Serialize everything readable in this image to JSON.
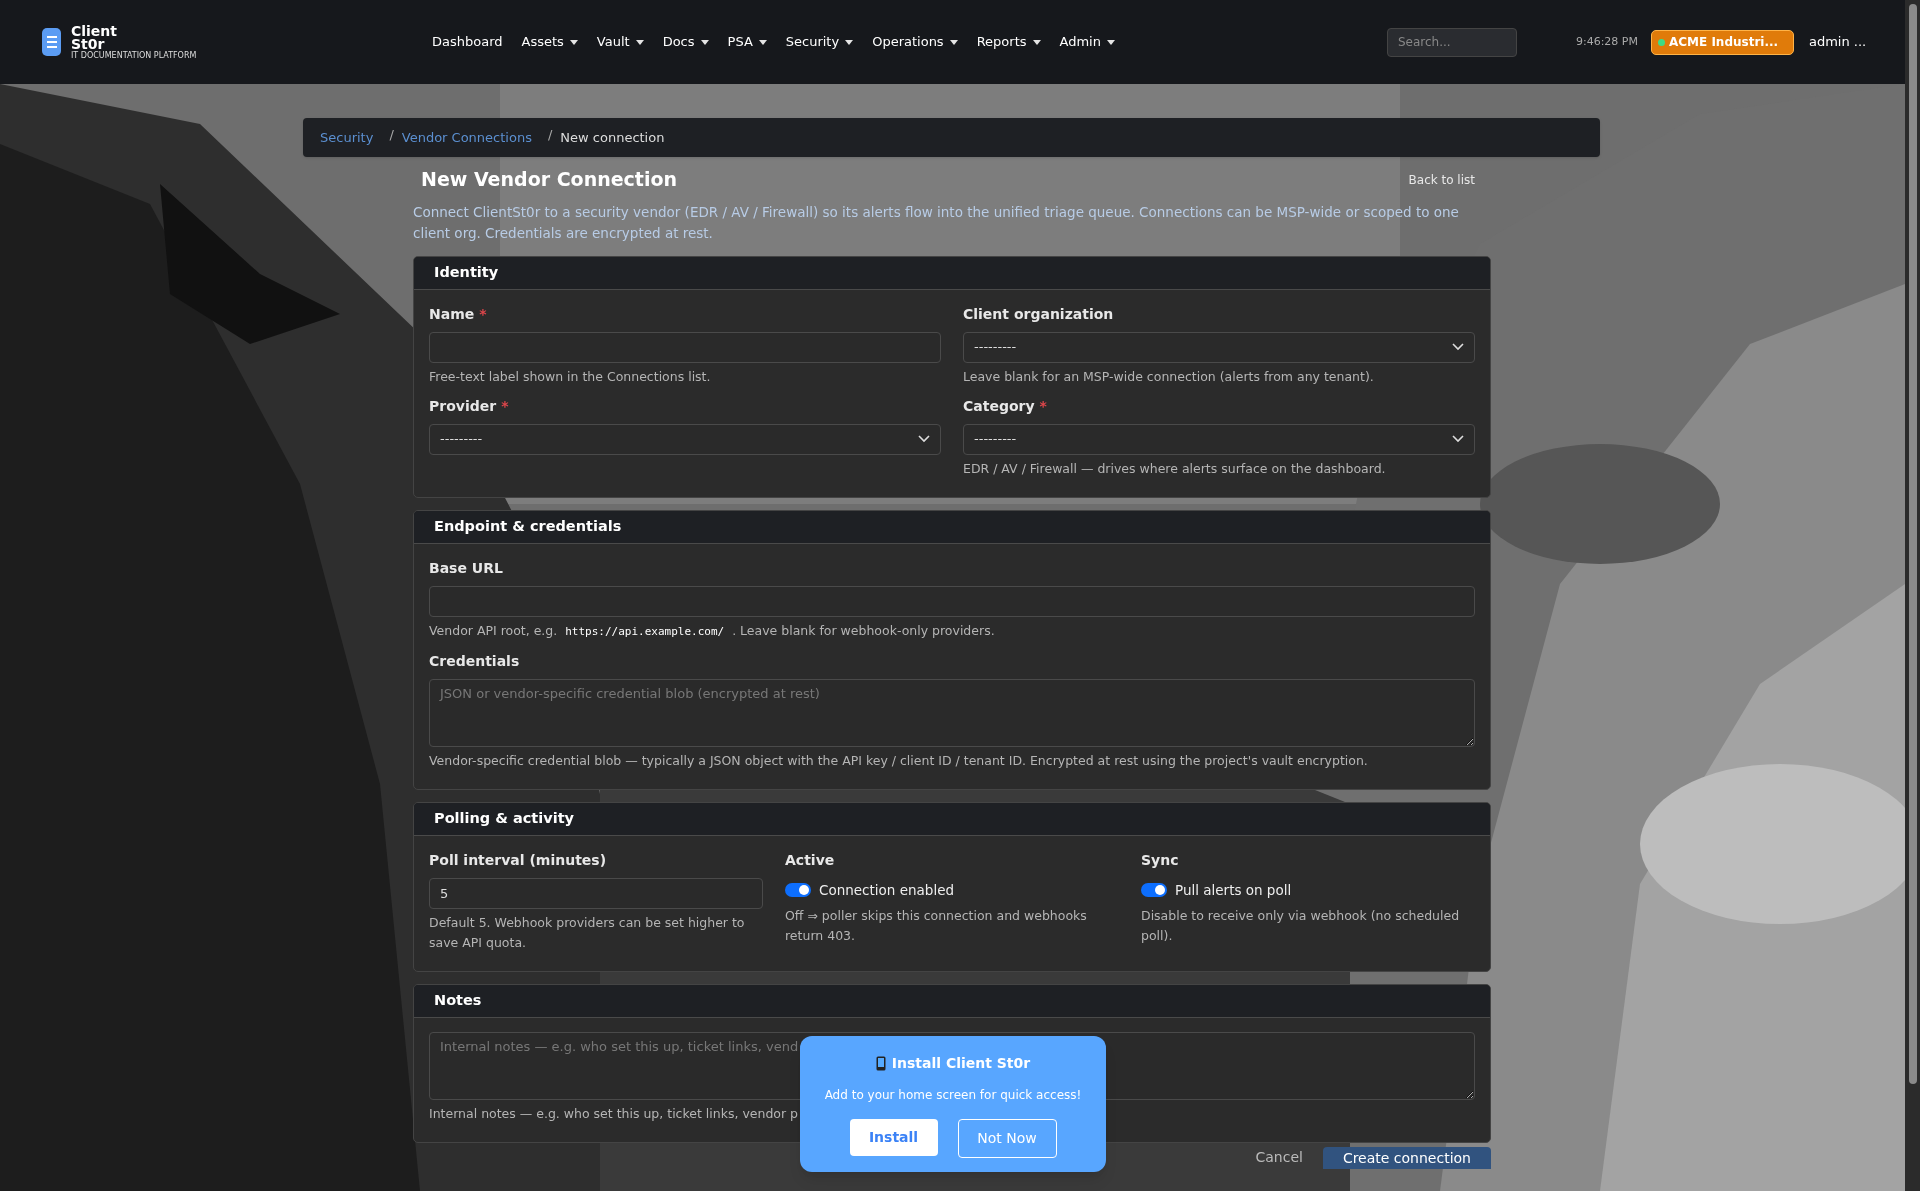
{
  "header": {
    "logo": {
      "title": "Client",
      "subtitle": "St0r",
      "tagline": "IT DOCUMENTATION PLATFORM"
    },
    "nav": [
      {
        "label": "Dashboard",
        "dropdown": false
      },
      {
        "label": "Assets",
        "dropdown": true
      },
      {
        "label": "Vault",
        "dropdown": true
      },
      {
        "label": "Docs",
        "dropdown": true
      },
      {
        "label": "PSA",
        "dropdown": true
      },
      {
        "label": "Security",
        "dropdown": true
      },
      {
        "label": "Operations",
        "dropdown": true
      },
      {
        "label": "Reports",
        "dropdown": true
      },
      {
        "label": "Admin",
        "dropdown": true
      }
    ],
    "search": {
      "placeholder": "Search..."
    },
    "clock": "9:46:28 PM",
    "org": "ACME Industri...",
    "user": "admin ..."
  },
  "breadcrumb": [
    {
      "label": "Security",
      "link": true
    },
    {
      "label": "Vendor Connections",
      "link": true,
      "separator": "/"
    },
    {
      "label": "New connection",
      "link": false,
      "separator": "/"
    }
  ],
  "page": {
    "title": "New Vendor Connection",
    "back_link": "Back to list",
    "description": "Connect ClientSt0r to a security vendor (EDR / AV / Firewall) so its alerts flow into the unified triage queue. Connections can be MSP-wide or scoped to one client org. Credentials are encrypted at rest."
  },
  "sections": [
    {
      "title": "Identity",
      "fields": [
        {
          "kind": "text",
          "label": "Name",
          "required_mark": "*",
          "help": [
            {
              "kind": "text",
              "text": "Free-text label shown in the Connections list."
            }
          ]
        },
        {
          "kind": "select",
          "label": "Client organization",
          "value": "---------",
          "help": [
            {
              "kind": "text",
              "text": "Leave blank for an MSP-wide connection (alerts from any tenant)."
            }
          ]
        },
        {
          "kind": "select",
          "label": "Provider",
          "required_mark": "*",
          "value": "---------"
        },
        {
          "kind": "select",
          "label": "Category",
          "required_mark": "*",
          "value": "---------",
          "help": [
            {
              "kind": "text",
              "text": "EDR / AV / Firewall — drives where alerts surface on the dashboard."
            }
          ]
        }
      ]
    },
    {
      "title": "Endpoint & credentials",
      "fields": [
        {
          "kind": "text",
          "label": "Base URL",
          "help": [
            {
              "kind": "text",
              "text": "Vendor API root, e.g. "
            },
            {
              "kind": "code",
              "text": "https://api.example.com/"
            },
            {
              "kind": "text",
              "text": " . Leave blank for webhook-only providers."
            }
          ]
        },
        {
          "kind": "textarea",
          "label": "Credentials",
          "placeholder": "JSON or vendor-specific credential blob (encrypted at rest)",
          "help": [
            {
              "kind": "text",
              "text": "Vendor-specific credential blob — typically a JSON object with the API key / client ID / tenant ID. Encrypted at rest using the project's vault encryption."
            }
          ]
        }
      ]
    },
    {
      "title": "Polling & activity",
      "fields": [
        {
          "kind": "text",
          "label": "Poll interval (minutes)",
          "value": "5",
          "help": [
            {
              "kind": "text",
              "text": "Default 5. Webhook providers can be set higher to save API quota."
            }
          ]
        },
        {
          "kind": "toggle",
          "label": "Active",
          "option": "Connection enabled",
          "on": true,
          "help": [
            {
              "kind": "text",
              "text": "Off ⇒ poller skips this connection and webhooks return 403."
            }
          ]
        },
        {
          "kind": "toggle",
          "label": "Sync",
          "option": "Pull alerts on poll",
          "on": true,
          "help": [
            {
              "kind": "text",
              "text": "Disable to receive only via webhook (no scheduled poll)."
            }
          ]
        }
      ]
    },
    {
      "title": "Notes",
      "fields": [
        {
          "kind": "textarea",
          "placeholder": "Internal notes — e.g. who set this up, ticket links, vend",
          "help": [
            {
              "kind": "text",
              "text": "Internal notes — e.g. who set this up, ticket links, vendor p"
            }
          ]
        }
      ]
    }
  ],
  "actions": {
    "cancel": "Cancel",
    "submit": "Create connection"
  },
  "install_prompt": {
    "title": "Install Client St0r",
    "message": "Add to your home screen for quick access!",
    "install": "Install",
    "dismiss": "Not Now"
  }
}
